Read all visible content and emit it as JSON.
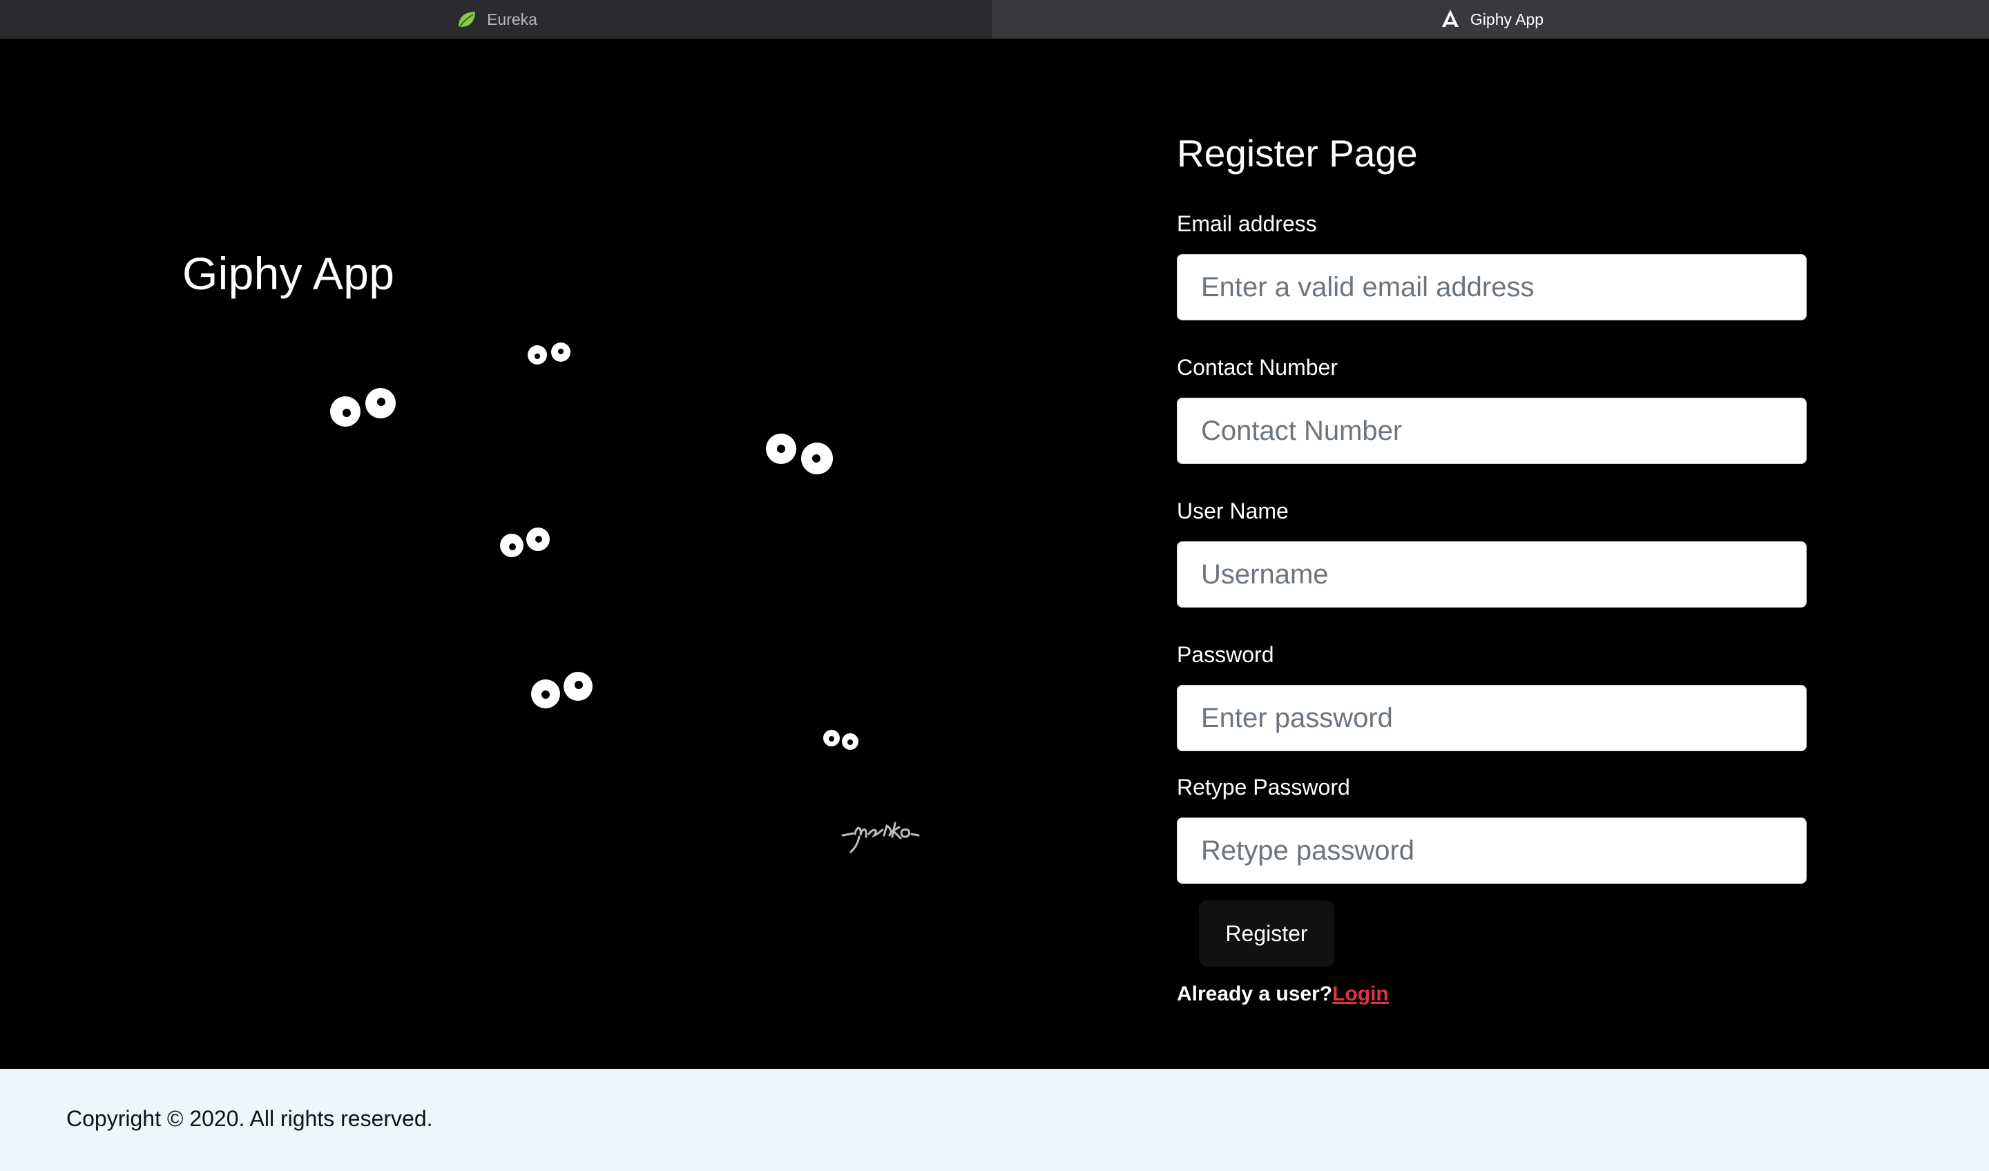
{
  "tabs": [
    {
      "label": "Eureka",
      "icon": "spring-leaf-icon",
      "active": false
    },
    {
      "label": "Giphy App",
      "icon": "angular-icon",
      "active": true
    }
  ],
  "hero": {
    "title": "Giphy App",
    "gif_signature": "marko"
  },
  "register": {
    "title": "Register Page",
    "fields": [
      {
        "label": "Email address",
        "placeholder": "Enter a valid email address",
        "value": ""
      },
      {
        "label": "Contact Number",
        "placeholder": "Contact Number",
        "value": ""
      },
      {
        "label": "User Name",
        "placeholder": "Username",
        "value": ""
      },
      {
        "label": "Password",
        "placeholder": "Enter password",
        "value": ""
      },
      {
        "label": "Retype Password",
        "placeholder": "Retype password",
        "value": ""
      }
    ],
    "button_label": "Register",
    "already_text": "Already a user?",
    "login_label": "Login"
  },
  "footer": {
    "copyright": "Copyright © 2020. All rights reserved."
  },
  "colors": {
    "background": "#000000",
    "footer_bg": "#eef6fd",
    "link": "#dc3545",
    "button_bg": "#111111"
  }
}
